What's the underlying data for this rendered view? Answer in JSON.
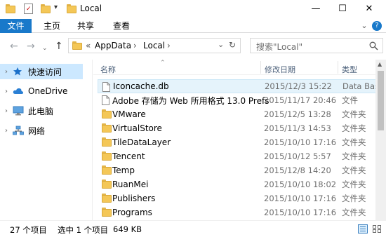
{
  "window": {
    "title": "Local",
    "minimize_glyph": "—",
    "maximize_glyph": "☐",
    "close_glyph": "✕"
  },
  "ribbon": {
    "tabs": [
      "文件",
      "主页",
      "共享",
      "查看"
    ],
    "expand_glyph": "⌄",
    "help_glyph": "?"
  },
  "address": {
    "crumbs": [
      "AppData",
      "Local"
    ],
    "sep_glyph": "›",
    "overflow_glyph": "«",
    "dropdown_glyph": "⌄"
  },
  "search": {
    "placeholder": "搜索\"Local\"",
    "icon": "search-icon"
  },
  "nav": {
    "items": [
      {
        "label": "快速访问",
        "icon": "star-icon"
      },
      {
        "label": "OneDrive",
        "icon": "cloud-icon"
      },
      {
        "label": "此电脑",
        "icon": "computer-icon"
      },
      {
        "label": "网络",
        "icon": "network-icon"
      }
    ]
  },
  "columns": {
    "name": "名称",
    "date": "修改日期",
    "type": "类型"
  },
  "files": [
    {
      "name": "Iconcache.db",
      "date": "2015/12/3 15:22",
      "type": "Data Bas",
      "kind": "file",
      "selected": true
    },
    {
      "name": "Adobe 存储为 Web 所用格式 13.0 Prefs",
      "date": "2015/11/17 20:46",
      "type": "文件",
      "kind": "file",
      "selected": false
    },
    {
      "name": "VMware",
      "date": "2015/12/5 13:28",
      "type": "文件夹",
      "kind": "folder",
      "selected": false
    },
    {
      "name": "VirtualStore",
      "date": "2015/11/3 14:53",
      "type": "文件夹",
      "kind": "folder",
      "selected": false
    },
    {
      "name": "TileDataLayer",
      "date": "2015/10/10 17:16",
      "type": "文件夹",
      "kind": "folder",
      "selected": false
    },
    {
      "name": "Tencent",
      "date": "2015/10/12 5:57",
      "type": "文件夹",
      "kind": "folder",
      "selected": false
    },
    {
      "name": "Temp",
      "date": "2015/12/8 14:20",
      "type": "文件夹",
      "kind": "folder",
      "selected": false
    },
    {
      "name": "RuanMei",
      "date": "2015/10/10 18:02",
      "type": "文件夹",
      "kind": "folder",
      "selected": false
    },
    {
      "name": "Publishers",
      "date": "2015/10/10 17:16",
      "type": "文件夹",
      "kind": "folder",
      "selected": false
    },
    {
      "name": "Programs",
      "date": "2015/10/10 17:16",
      "type": "文件夹",
      "kind": "folder",
      "selected": false
    }
  ],
  "status": {
    "count": "27 个项目",
    "selection": "选中 1 个项目",
    "size": "649 KB"
  },
  "colors": {
    "accent": "#1979ca",
    "folder": "#f4c757",
    "selected_row": "#e5f3fb"
  }
}
